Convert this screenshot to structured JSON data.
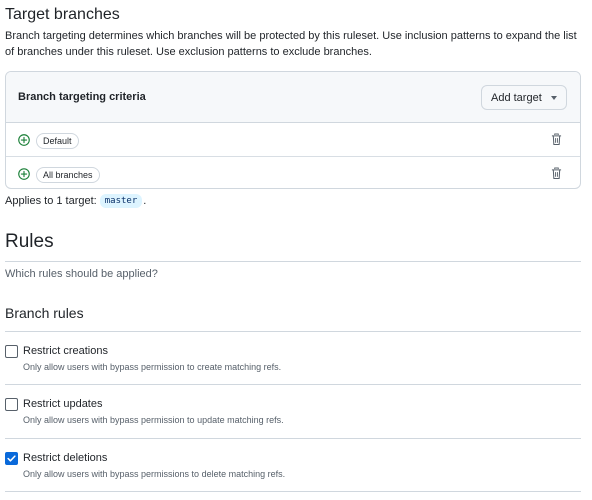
{
  "target": {
    "title": "Target branches",
    "description": "Branch targeting determines which branches will be protected by this ruleset. Use inclusion patterns to expand the list of branches under this ruleset. Use exclusion patterns to exclude branches."
  },
  "criteria": {
    "title": "Branch targeting criteria",
    "add_target_label": "Add target",
    "items": [
      {
        "label": "Default"
      },
      {
        "label": "All branches"
      }
    ]
  },
  "applies": {
    "prefix": "Applies to 1 target:",
    "target_name": "master",
    "suffix": "."
  },
  "rules": {
    "title": "Rules",
    "description": "Which rules should be applied?",
    "branch_rules_title": "Branch rules",
    "items": [
      {
        "name": "Restrict creations",
        "description": "Only allow users with bypass permission to create matching refs.",
        "checked": false
      },
      {
        "name": "Restrict updates",
        "description": "Only allow users with bypass permission to update matching refs.",
        "checked": false
      },
      {
        "name": "Restrict deletions",
        "description": "Only allow users with bypass permissions to delete matching refs.",
        "checked": true
      }
    ]
  },
  "colors": {
    "accent": "#0969da",
    "success": "#1a7f37",
    "border": "#d0d7de",
    "muted_text": "#57606a"
  },
  "icons": {
    "plus": "plus-circle-icon",
    "trash": "trash-icon",
    "caret": "triangle-down-icon",
    "check": "check-icon"
  }
}
